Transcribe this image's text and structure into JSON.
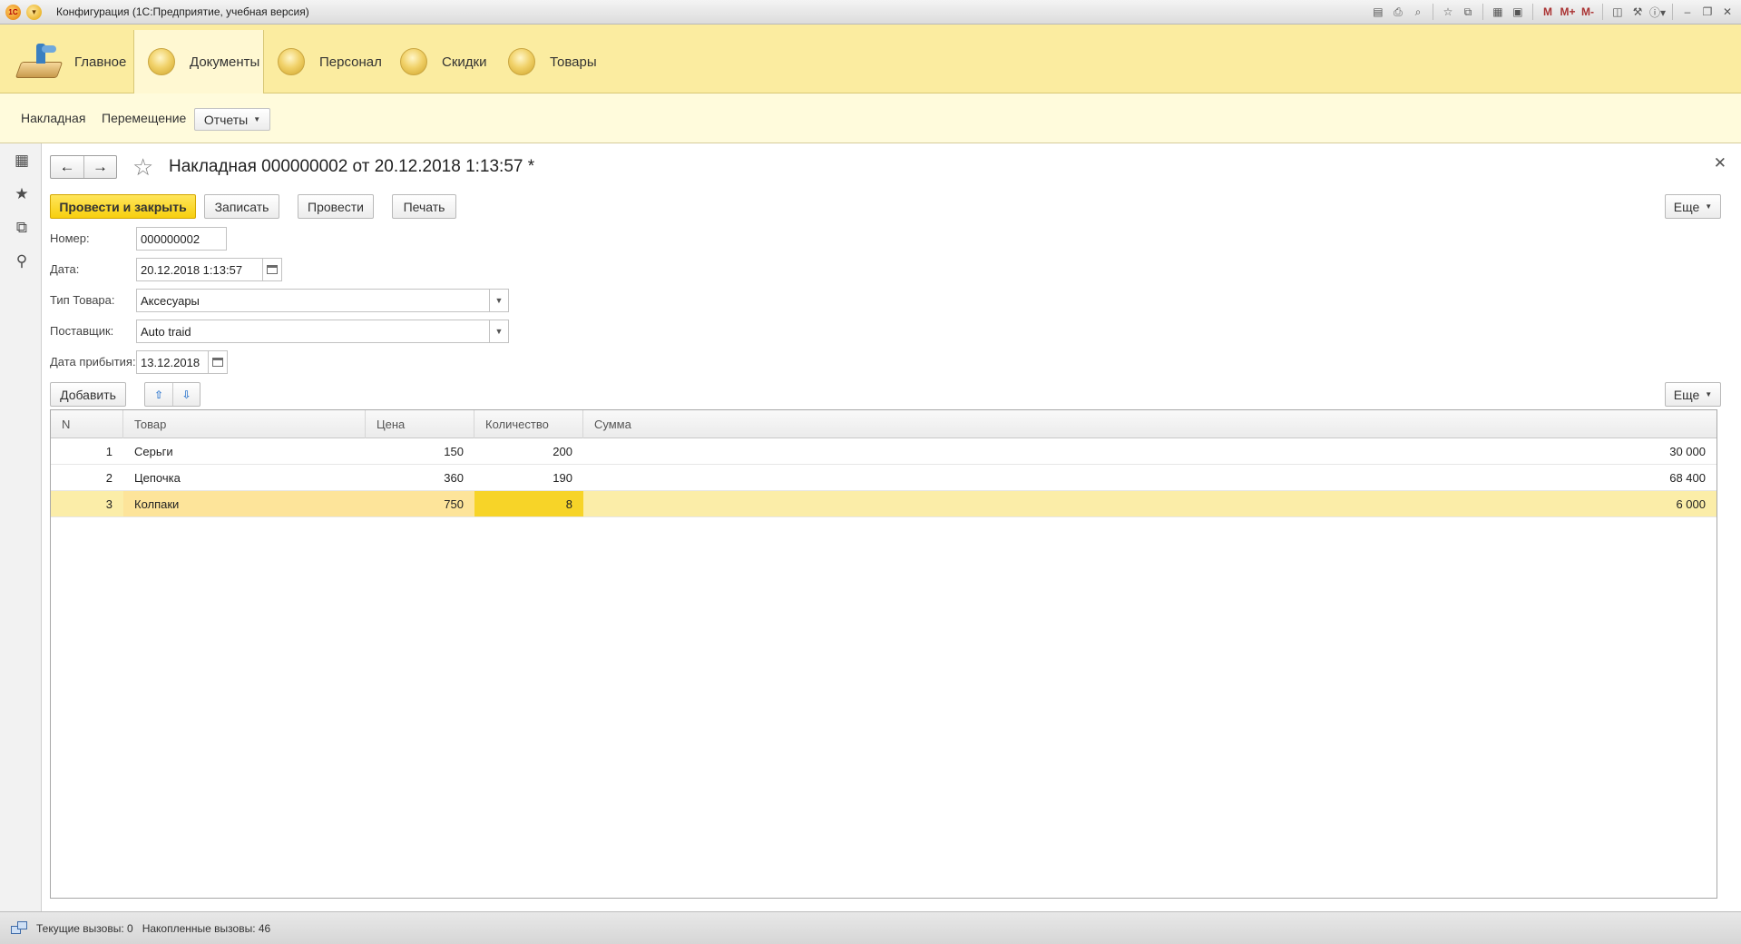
{
  "titlebar": {
    "logo": "1С",
    "title": "Конфигурация  (1С:Предприятие, учебная версия)",
    "tools": [
      "M",
      "M+",
      "M-"
    ]
  },
  "sections": [
    {
      "label": "Главное",
      "icon": "home-desk-icon",
      "active": false
    },
    {
      "label": "Документы",
      "icon": "section-orb-icon",
      "active": true
    },
    {
      "label": "Персонал",
      "icon": "section-orb-icon",
      "active": false
    },
    {
      "label": "Скидки",
      "icon": "section-orb-icon",
      "active": false
    },
    {
      "label": "Товары",
      "icon": "section-orb-icon",
      "active": false
    }
  ],
  "function_panel": {
    "links": [
      "Накладная",
      "Перемещение"
    ],
    "reports_button": "Отчеты"
  },
  "form": {
    "title": "Накладная 000000002 от 20.12.2018 1:13:57 *",
    "buttons": {
      "post_close": "Провести и закрыть",
      "save": "Записать",
      "post": "Провести",
      "print": "Печать",
      "more": "Еще"
    },
    "fields": {
      "number_label": "Номер:",
      "number_value": "000000002",
      "date_label": "Дата:",
      "date_value": "20.12.2018  1:13:57",
      "type_label": "Тип Товара:",
      "type_value": "Аксесуары",
      "supplier_label": "Поставщик:",
      "supplier_value": "Auto traid",
      "arrival_label": "Дата прибытия:",
      "arrival_value": "13.12.2018"
    },
    "table_toolbar": {
      "add": "Добавить",
      "more": "Еще"
    },
    "table": {
      "columns": [
        "N",
        "Товар",
        "Цена",
        "Количество",
        "Сумма"
      ],
      "rows": [
        {
          "n": "1",
          "item": "Серьги",
          "price": "150",
          "qty": "200",
          "sum": "30 000",
          "selected": false
        },
        {
          "n": "2",
          "item": "Цепочка",
          "price": "360",
          "qty": "190",
          "sum": "68 400",
          "selected": false
        },
        {
          "n": "3",
          "item": "Колпаки",
          "price": "750",
          "qty": "8",
          "sum": "6 000",
          "selected": true
        }
      ]
    }
  },
  "statusbar": {
    "current_calls": "Текущие вызовы: 0",
    "accumulated_calls": "Накопленные вызовы: 46"
  },
  "colors": {
    "sections_bg": "#fbeca0",
    "function_panel_bg": "#fffbdc",
    "primary_button": "#f7cf0e",
    "selected_row": "#fbeda8",
    "current_cell": "#f7d428"
  }
}
